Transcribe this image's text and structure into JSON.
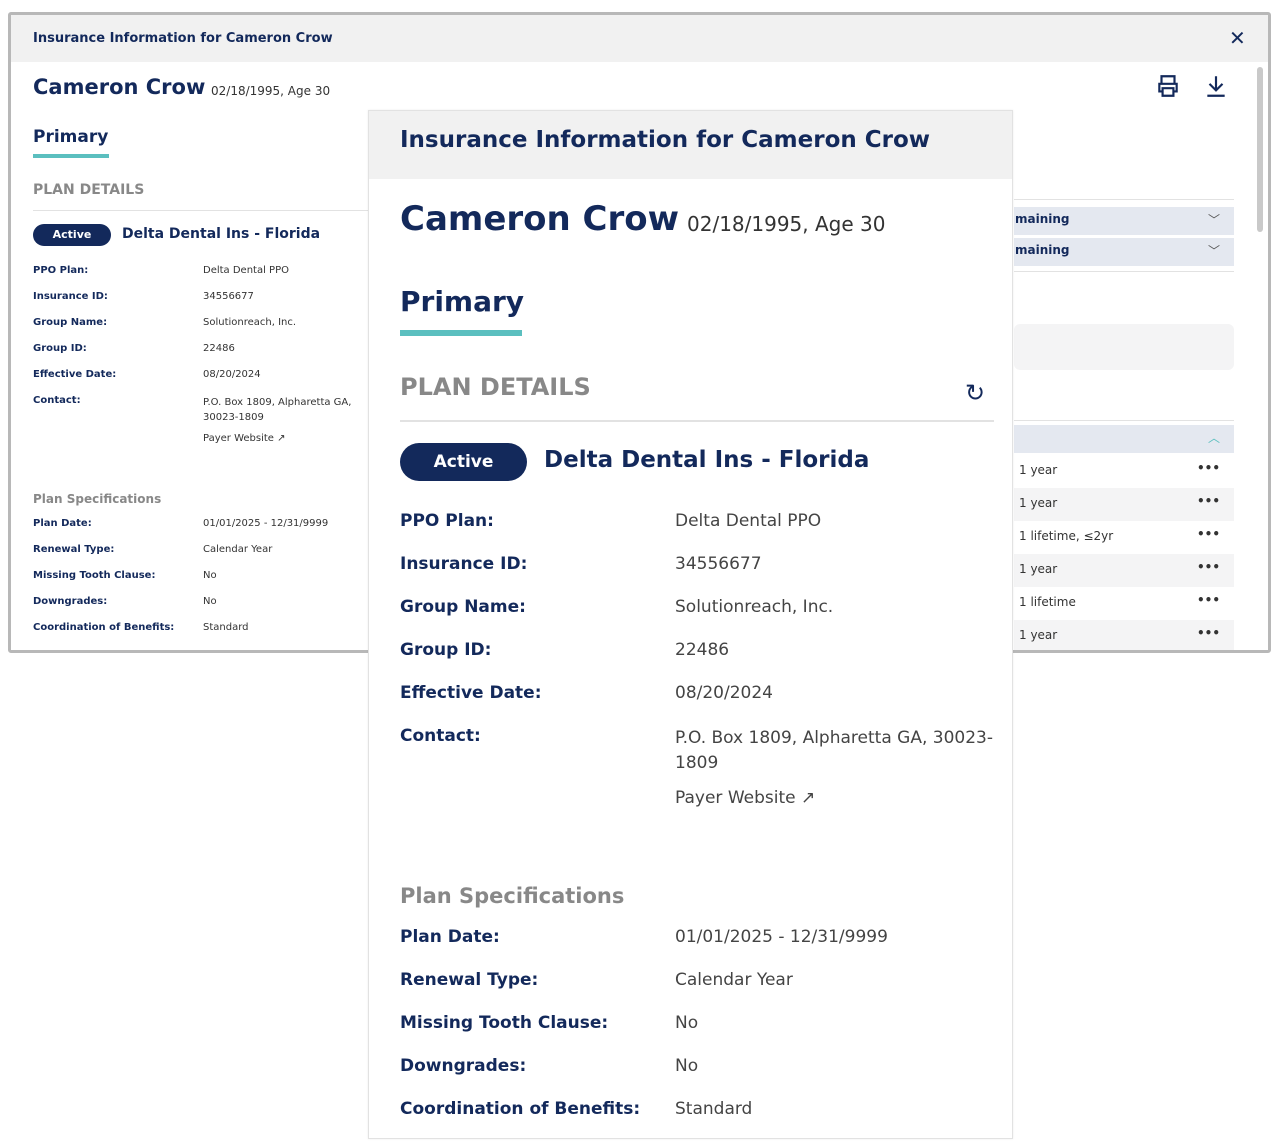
{
  "modal": {
    "title": "Insurance Information for Cameron Crow",
    "close_icon": "close-icon",
    "print_icon": "printer-icon",
    "download_icon": "download-icon"
  },
  "patient": {
    "name": "Cameron Crow",
    "dob_age": "02/18/1995, Age 30"
  },
  "tab": "Primary",
  "plan_details": {
    "heading": "PLAN DETAILS",
    "status": "Active",
    "carrier": "Delta Dental Ins - Florida",
    "fields": [
      {
        "label": "PPO Plan:",
        "value": "Delta Dental PPO"
      },
      {
        "label": "Insurance ID:",
        "value": "34556677"
      },
      {
        "label": "Group Name:",
        "value": "Solutionreach, Inc."
      },
      {
        "label": "Group ID:",
        "value": "22486"
      },
      {
        "label": "Effective Date:",
        "value": "08/20/2024"
      },
      {
        "label": "Contact:",
        "value": "P.O. Box 1809, Alpharetta GA, 30023-1809"
      }
    ],
    "payer_link": "Payer Website"
  },
  "plan_specs": {
    "heading": "Plan Specifications",
    "fields": [
      {
        "label": "Plan Date:",
        "value": "01/01/2025 - 12/31/9999"
      },
      {
        "label": "Renewal Type:",
        "value": "Calendar Year"
      },
      {
        "label": "Missing Tooth Clause:",
        "value": "No"
      },
      {
        "label": "Downgrades:",
        "value": "No"
      },
      {
        "label": "Coordination of Benefits:",
        "value": "Standard"
      }
    ]
  },
  "right": {
    "accordions": [
      "maining",
      "maining"
    ],
    "frequencies": [
      "1 year",
      "1 year",
      "1 lifetime, ≤2yr",
      "1 year",
      "1 lifetime",
      "1 year"
    ],
    "more": "•••"
  },
  "colors": {
    "navy": "#13295b",
    "teal": "#5bbfbf",
    "header_bg": "#f1f1f1"
  }
}
